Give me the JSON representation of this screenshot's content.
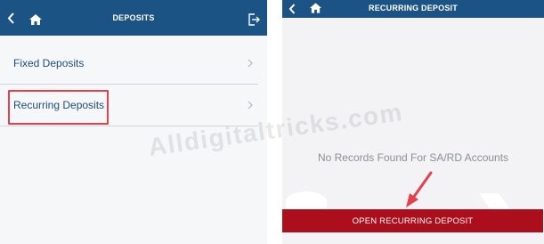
{
  "left_screen": {
    "title": "DEPOSITS",
    "menu": [
      {
        "label": "Fixed Deposits",
        "icon": "chevron-right-icon"
      },
      {
        "label": "Recurring Deposits",
        "icon": "chevron-right-icon"
      }
    ],
    "icons": [
      "back-arrow-icon",
      "home-icon",
      "logout-icon"
    ]
  },
  "right_screen": {
    "title": "RECURRING DEPOSIT",
    "empty_message": "No Records Found For SA/RD Accounts",
    "open_button_label": "OPEN RECURRING DEPOSIT",
    "icons": [
      "back-arrow-icon",
      "home-icon"
    ]
  },
  "watermark": "Alldigitaltricks.com",
  "colors": {
    "header": "#1c5385",
    "menu_text": "#1d4d7a",
    "highlight": "#e2414d",
    "button": "#ad0e1c",
    "empty_text": "#8c8f94"
  }
}
